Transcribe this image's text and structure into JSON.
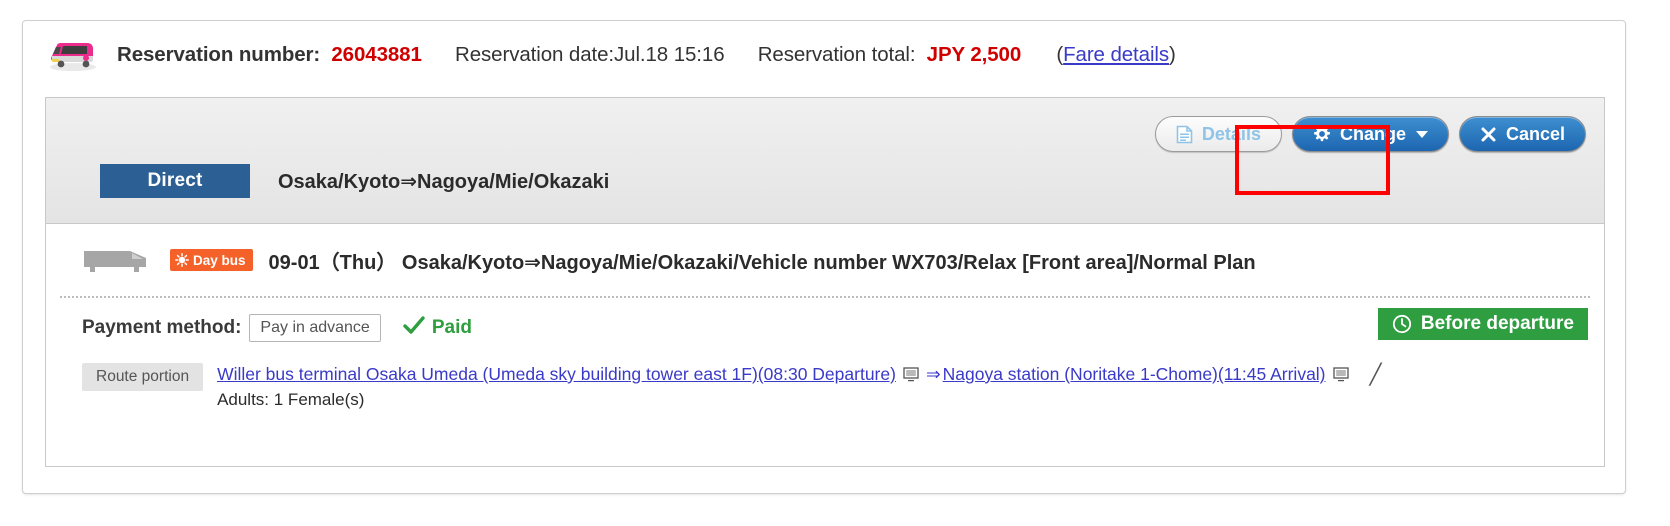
{
  "header": {
    "logo_icon": "pink-bus-logo",
    "reservation_number_label": "Reservation number:",
    "reservation_number": "26043881",
    "reservation_date": "Reservation date:Jul.18 15:16",
    "reservation_total_label": "Reservation total:",
    "reservation_total": "JPY 2,500",
    "fare_details_open": "(",
    "fare_details_link": "Fare details",
    "fare_details_close": ")"
  },
  "actions": {
    "details_label": "Details",
    "details_icon": "document-icon",
    "change_label": "Change",
    "change_icon": "gear-icon",
    "change_caret_icon": "chevron-down-icon",
    "cancel_label": "Cancel",
    "cancel_icon": "close-x-icon",
    "highlight_color": "#ff0000",
    "highlight_target": "change-button"
  },
  "band": {
    "direct_label": "Direct",
    "direct_bg": "#2c5f93",
    "route_title": "Osaka/Kyoto⇒Nagoya/Mie/Okazaki"
  },
  "trip": {
    "bus_icon": "side-bus-icon",
    "day_bus_badge": "Day bus",
    "day_bus_icon": "sun-icon",
    "day_bus_bg": "#f4622a",
    "description": "09-01（Thu） Osaka/Kyoto⇒Nagoya/Mie/Okazaki/Vehicle number WX703/Relax [Front area]/Normal Plan"
  },
  "payment": {
    "label": "Payment method:",
    "method_value": "Pay in advance",
    "paid_icon": "check-icon",
    "paid_label": "Paid",
    "paid_color": "#2e9e3e",
    "status_icon": "clock-icon",
    "status_label": "Before departure",
    "status_bg": "#2f9e41"
  },
  "route": {
    "tag_label": "Route portion",
    "departure_link": "Willer bus terminal Osaka Umeda (Umeda sky building tower east 1F)(08:30 Departure)",
    "departure_map_icon": "map-screen-icon",
    "arrow_icon": "double-arrow-right",
    "arrival_link": "Nagoya station (Noritake 1-Chome)(11:45 Arrival)",
    "arrival_map_icon": "map-screen-icon",
    "trailing_icon": "slash-icon",
    "trailing_glyph": "╱",
    "passengers": "Adults: 1 Female(s)"
  }
}
